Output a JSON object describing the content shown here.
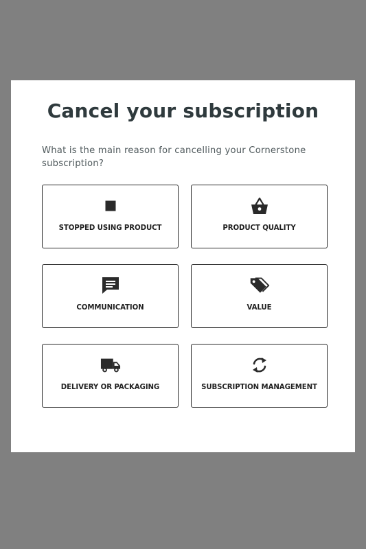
{
  "modal": {
    "title": "Cancel your subscription",
    "question": "What is the main reason for cancelling your Cornerstone subscription?"
  },
  "options": [
    {
      "label": "STOPPED USING PRODUCT",
      "icon": "stop-icon"
    },
    {
      "label": "PRODUCT QUALITY",
      "icon": "basket-icon"
    },
    {
      "label": "COMMUNICATION",
      "icon": "message-icon"
    },
    {
      "label": "VALUE",
      "icon": "price-tags-icon"
    },
    {
      "label": "DELIVERY OR PACKAGING",
      "icon": "truck-icon"
    },
    {
      "label": "SUBSCRIPTION MANAGEMENT",
      "icon": "refresh-icon"
    }
  ],
  "colors": {
    "backdrop": "#808080",
    "modal_background": "#ffffff",
    "title": "#2f3a3d",
    "text": "#505a5d",
    "border": "#2a2a2a",
    "icon": "#2a2a2a"
  }
}
